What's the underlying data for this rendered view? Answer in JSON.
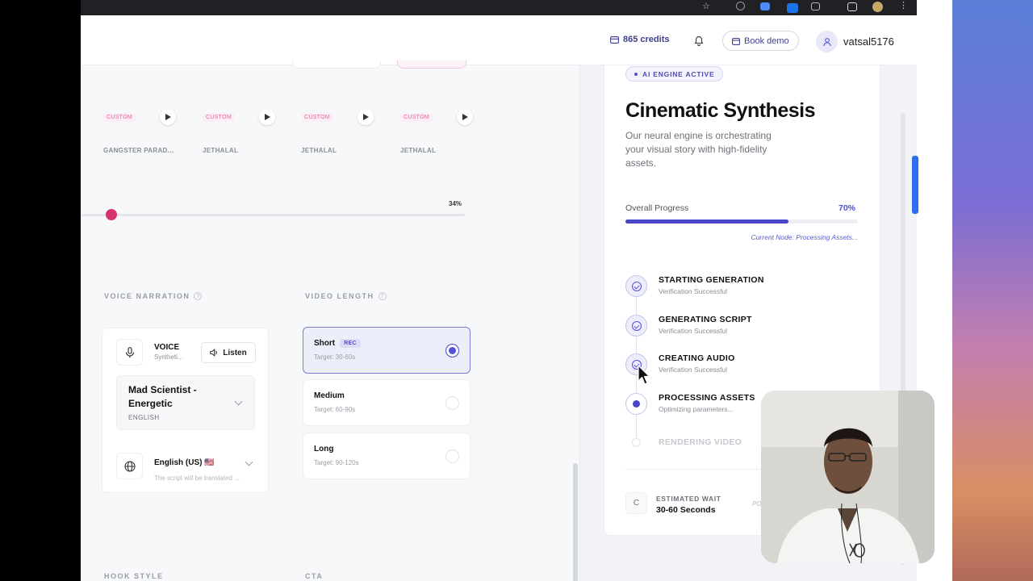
{
  "header": {
    "credits": "865 credits",
    "book_demo": "Book demo",
    "username": "vatsal5176"
  },
  "voice_cards": [
    {
      "badge": "CUSTOM",
      "name": "GANGSTER PARAD..."
    },
    {
      "badge": "CUSTOM",
      "name": "JETHALAL"
    },
    {
      "badge": "CUSTOM",
      "name": "JETHALAL"
    },
    {
      "badge": "CUSTOM",
      "name": "JETHALAL"
    }
  ],
  "slider": {
    "value_label": "34%",
    "value": 0.07
  },
  "voice_narration": {
    "section_label": "VOICE NARRATION",
    "voice_label": "VOICE",
    "voice_sub": "Syntheti...",
    "listen": "Listen",
    "selected_voice": "Mad Scientist - Energetic",
    "selected_voice_lang": "ENGLISH",
    "language": "English (US) 🇺🇸",
    "language_note": "The script will be translated ..."
  },
  "video_length": {
    "section_label": "VIDEO LENGTH",
    "options": [
      {
        "title": "Short",
        "badge": "REC",
        "target": "Target: 30-60s",
        "selected": true
      },
      {
        "title": "Medium",
        "badge": "",
        "target": "Target: 60-90s",
        "selected": false
      },
      {
        "title": "Long",
        "badge": "",
        "target": "Target: 90-120s",
        "selected": false
      }
    ]
  },
  "bottom_labels": {
    "hook_style": "HOOK STYLE",
    "cta": "CTA"
  },
  "generation": {
    "badge": "AI ENGINE ACTIVE",
    "title": "Cinematic Synthesis",
    "description": "Our neural engine is orchestrating your visual story with high-fidelity assets.",
    "progress_label": "Overall Progress",
    "progress_pct": "70%",
    "progress_value": 0.7,
    "current_node": "Current Node: Processing Assets...",
    "steps": [
      {
        "title": "STARTING GENERATION",
        "sub": "Verification Successful",
        "state": "done"
      },
      {
        "title": "GENERATING SCRIPT",
        "sub": "Verification Successful",
        "state": "done"
      },
      {
        "title": "CREATING AUDIO",
        "sub": "Verification Successful",
        "state": "done"
      },
      {
        "title": "PROCESSING ASSETS",
        "sub": "Optimizing parameters...",
        "state": "active"
      },
      {
        "title": "RENDERING VIDEO",
        "sub": "",
        "state": "pending"
      }
    ],
    "wait_icon": "C",
    "wait_label": "ESTIMATED WAIT",
    "wait_value": "30-60 Seconds",
    "wait_extra": "PO"
  },
  "colors": {
    "accent": "#4a48c8",
    "pink": "#d6326f",
    "badge_pink": "#e0649a"
  }
}
